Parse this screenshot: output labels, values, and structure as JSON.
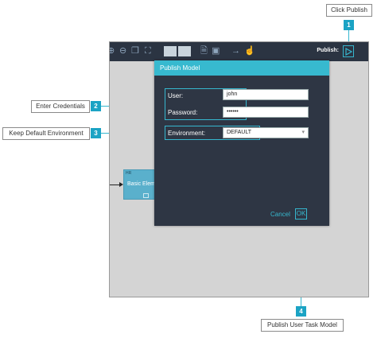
{
  "callouts": {
    "c1": {
      "number": "1",
      "text": "Click Publish"
    },
    "c2": {
      "number": "2",
      "text": "Enter Credentials"
    },
    "c3": {
      "number": "3",
      "text": "Keep Default Environment"
    },
    "c4": {
      "number": "4",
      "text": "Publish User Task Model"
    }
  },
  "toolbar": {
    "icons": [
      "zoom-in-icon",
      "zoom-out-icon",
      "fit-icon",
      "fullscreen-icon",
      "grid-view-icon",
      "tile-view-icon",
      "document-icon",
      "image-icon",
      "arrow-icon",
      "hand-icon"
    ],
    "publish_label": "Publish:",
    "publish_icon": "play-icon"
  },
  "canvas": {
    "node_tag": "HR",
    "node_label": "Basic Elem"
  },
  "dialog": {
    "title": "Publish Model",
    "user_label": "User:",
    "user_value": "john",
    "password_label": "Password:",
    "password_value": "••••••",
    "environment_label": "Environment:",
    "environment_value": "DEFAULT",
    "cancel_label": "Cancel",
    "ok_label": "OK"
  },
  "colors": {
    "accent": "#36b7cf",
    "badge": "#1ba3c4",
    "toolbar": "#2b3442",
    "dialog_bg": "#2e3644",
    "canvas_bg": "#d4d4d4"
  }
}
